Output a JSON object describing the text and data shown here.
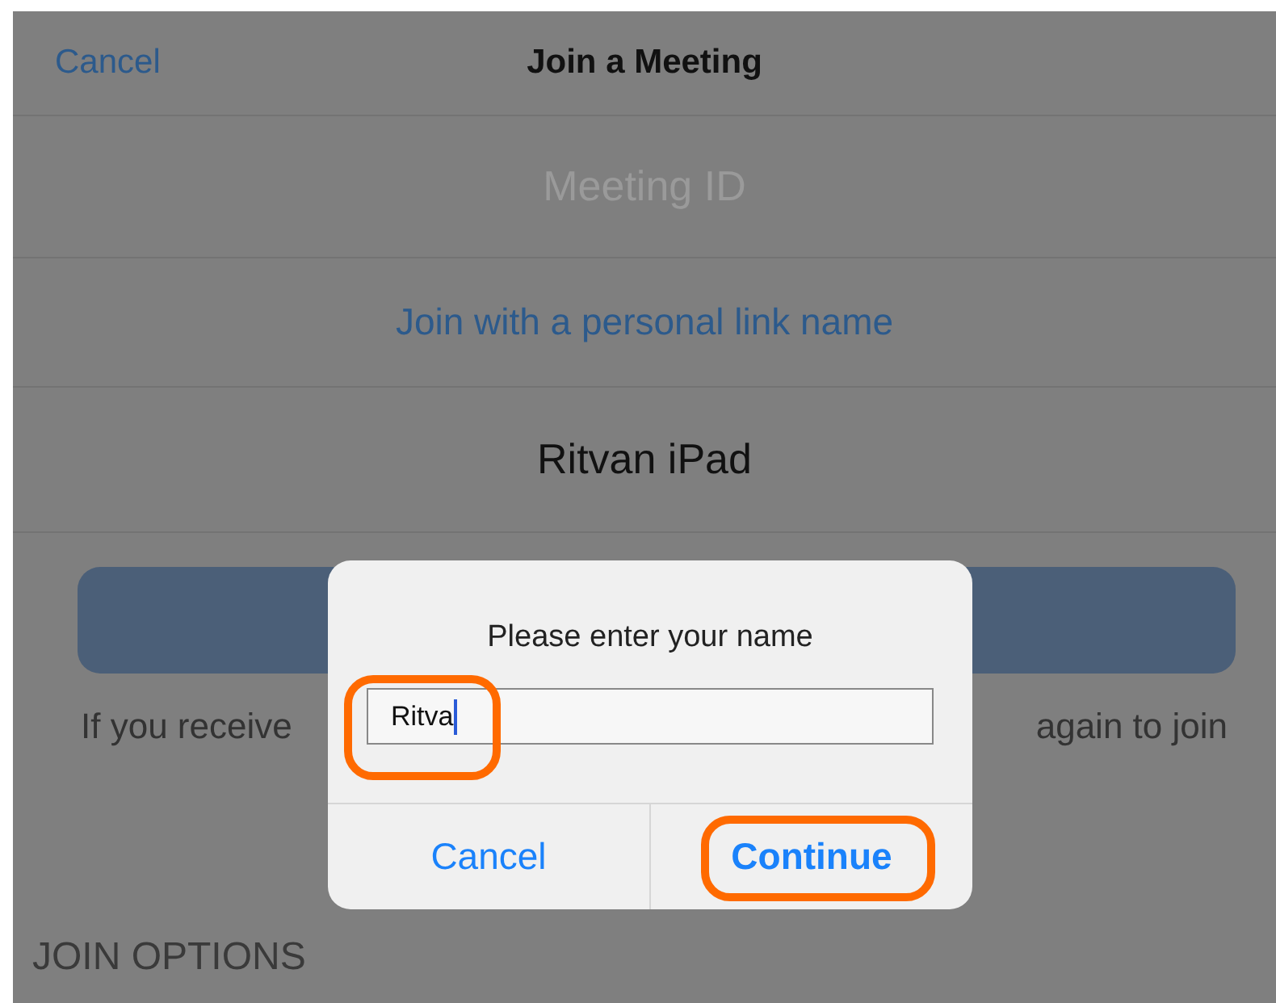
{
  "nav_bar": {
    "cancel": "Cancel",
    "title": "Join a Meeting"
  },
  "form": {
    "meeting_id": {
      "placeholder": "Meeting ID"
    },
    "personal_link": "Join with a personal link name",
    "display_name": "Ritvan iPad"
  },
  "info_text": {
    "left_part": "If you receive",
    "right_part": "again to join"
  },
  "join_options_heading": "JOIN OPTIONS",
  "dialog": {
    "title": "Please enter your name",
    "name_field": {
      "value": "Ritva",
      "focused": true
    },
    "buttons": [
      {
        "label": "Cancel",
        "highlighted": false
      },
      {
        "label": "Continue",
        "highlighted": true
      }
    ]
  }
}
